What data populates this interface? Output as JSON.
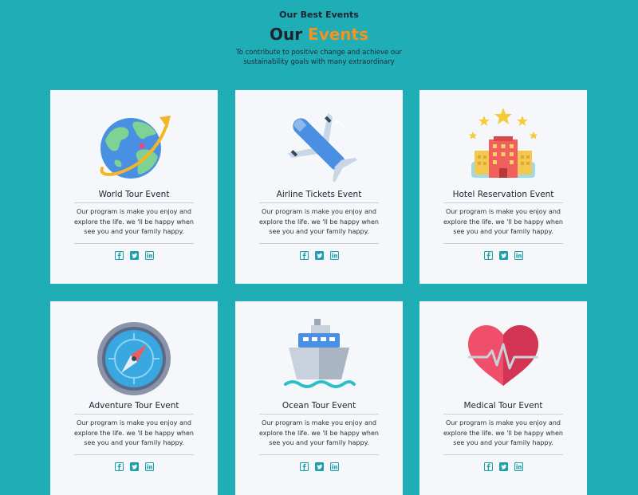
{
  "header": {
    "subheading": "Our Best Events",
    "title_main": "Our",
    "title_accent": "Events",
    "tagline": "To contribute to positive change and achieve our sustainability goals with many extraordinary"
  },
  "colors": {
    "background": "#1fadb6",
    "accent": "#f4931f",
    "card_bg": "#f5f7fa",
    "social": "#1aa0a8"
  },
  "cards": [
    {
      "title": "World Tour Event",
      "description": "Our program is make you enjoy and explore the life. we 'll be happy when see you and your family happy.",
      "icon": "globe-icon"
    },
    {
      "title": "Airline Tickets Event",
      "description": "Our program is make you enjoy and explore the life. we 'll be happy when see you and your family happy.",
      "icon": "airplane-icon"
    },
    {
      "title": "Hotel Reservation Event",
      "description": "Our program is make you enjoy and explore the life. we 'll be happy when see you and your family happy.",
      "icon": "hotel-icon"
    },
    {
      "title": "Adventure Tour Event",
      "description": "Our program is make you enjoy and explore the life. we 'll be happy when see you and your family happy.",
      "icon": "compass-icon"
    },
    {
      "title": "Ocean Tour Event",
      "description": "Our program is make you enjoy and explore the life. we 'll be happy when see you and your family happy.",
      "icon": "ship-icon"
    },
    {
      "title": "Medical Tour Event",
      "description": "Our program is make you enjoy and explore the life. we 'll be happy when see you and your family happy.",
      "icon": "heart-icon"
    }
  ],
  "social": [
    "facebook-icon",
    "twitter-icon",
    "linkedin-icon"
  ]
}
